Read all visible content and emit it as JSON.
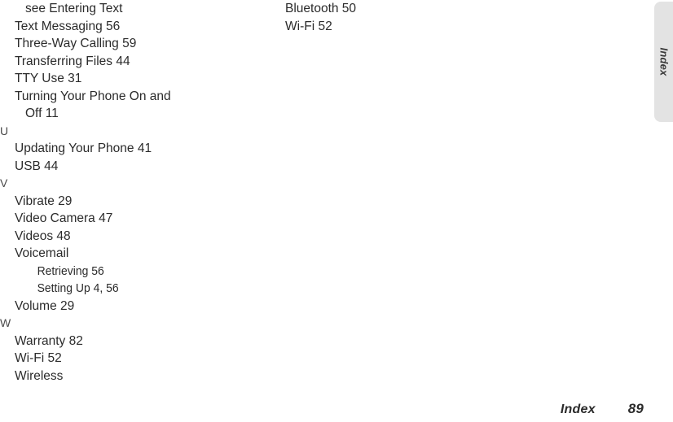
{
  "document": {
    "section_tab_label": "Index",
    "tab_color": "#e3e3e3"
  },
  "footer": {
    "section_label": "Index",
    "page_number": "89"
  },
  "index": {
    "left_column": [
      {
        "type": "entry-cont",
        "text": "see Entering Text"
      },
      {
        "type": "entry",
        "text": "Text Messaging 56"
      },
      {
        "type": "entry",
        "text": "Three-Way Calling 59"
      },
      {
        "type": "entry",
        "text": "Transferring Files 44"
      },
      {
        "type": "entry",
        "text": "TTY Use 31"
      },
      {
        "type": "entry",
        "text": "Turning Your Phone On and"
      },
      {
        "type": "entry-cont",
        "text": "Off 11"
      },
      {
        "type": "letter",
        "text": "U"
      },
      {
        "type": "entry",
        "text": "Updating Your Phone 41"
      },
      {
        "type": "entry",
        "text": "USB 44"
      },
      {
        "type": "letter",
        "text": "V"
      },
      {
        "type": "entry",
        "text": "Vibrate 29"
      },
      {
        "type": "entry",
        "text": "Video Camera 47"
      },
      {
        "type": "entry",
        "text": "Videos 48"
      },
      {
        "type": "entry",
        "text": "Voicemail"
      },
      {
        "type": "subentry",
        "text": "Retrieving 56"
      },
      {
        "type": "subentry",
        "text": "Setting Up 4, 56"
      },
      {
        "type": "entry",
        "text": "Volume 29"
      },
      {
        "type": "letter",
        "text": "W"
      },
      {
        "type": "entry",
        "text": "Warranty 82"
      },
      {
        "type": "entry",
        "text": "Wi-Fi 52"
      },
      {
        "type": "entry",
        "text": "Wireless"
      }
    ],
    "right_column": [
      {
        "type": "entry-plain",
        "text": "Bluetooth 50"
      },
      {
        "type": "entry-plain",
        "text": "Wi-Fi 52"
      }
    ]
  }
}
